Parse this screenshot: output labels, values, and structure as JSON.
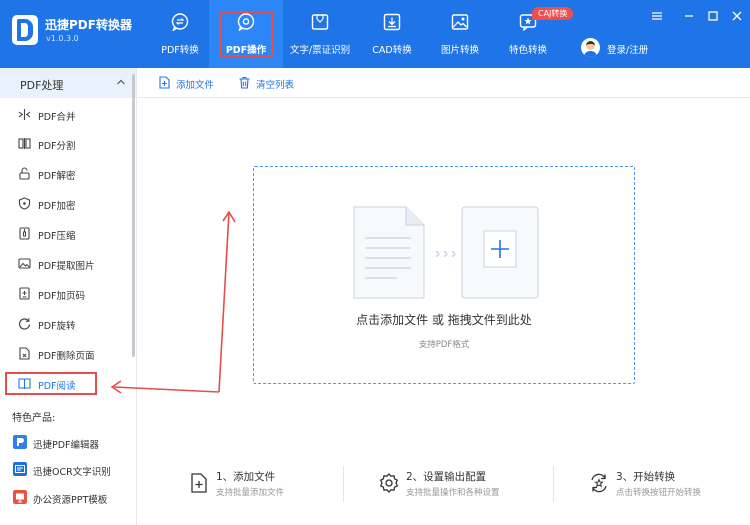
{
  "app": {
    "title": "迅捷PDF转换器",
    "version": "v1.0.3.0"
  },
  "nav": {
    "tabs": [
      {
        "label": "PDF转换",
        "icon": "chat-swap-icon"
      },
      {
        "label": "PDF操作",
        "icon": "chat-gear-icon"
      },
      {
        "label": "文字/票证识别",
        "icon": "scan-frame-icon"
      },
      {
        "label": "CAD转换",
        "icon": "download-box-icon"
      },
      {
        "label": "图片转换",
        "icon": "image-icon"
      },
      {
        "label": "特色转换",
        "icon": "star-chat-icon"
      }
    ],
    "badge": "CAJ转换",
    "login": "登录/注册"
  },
  "sidebar": {
    "header": "PDF处理",
    "items": [
      {
        "label": "PDF合并",
        "icon": "merge-icon"
      },
      {
        "label": "PDF分割",
        "icon": "split-icon"
      },
      {
        "label": "PDF解密",
        "icon": "unlock-icon"
      },
      {
        "label": "PDF加密",
        "icon": "shield-icon"
      },
      {
        "label": "PDF压缩",
        "icon": "compress-icon"
      },
      {
        "label": "PDF提取图片",
        "icon": "image-icon"
      },
      {
        "label": "PDF加页码",
        "icon": "page-number-icon"
      },
      {
        "label": "PDF旋转",
        "icon": "rotate-icon"
      },
      {
        "label": "PDF删除页面",
        "icon": "delete-page-icon"
      },
      {
        "label": "PDF阅读",
        "icon": "book-icon"
      }
    ],
    "selected": "PDF阅读",
    "featured_title": "特色产品:",
    "products": [
      {
        "label": "迅捷PDF编辑器",
        "icon": "pdf-editor-icon",
        "color": "#2f80ed"
      },
      {
        "label": "迅捷OCR文字识别",
        "icon": "ocr-icon",
        "color": "#1f6fd6"
      },
      {
        "label": "办公资源PPT模板",
        "icon": "ppt-icon",
        "color": "#e8553e"
      }
    ]
  },
  "toolbar": {
    "add_file": "添加文件",
    "clear_list": "清空列表"
  },
  "dropzone": {
    "main_text": "点击添加文件 或 拖拽文件到此处",
    "sub_text": "支持PDF格式"
  },
  "steps": [
    {
      "title": "1、添加文件",
      "desc": "支持批量添加文件",
      "icon": "add-file-icon"
    },
    {
      "title": "2、设置输出配置",
      "desc": "支持批量操作和各种设置",
      "icon": "settings-icon"
    },
    {
      "title": "3、开始转换",
      "desc": "点击转换按钮开始转换",
      "icon": "convert-icon"
    }
  ],
  "colors": {
    "brand": "#1f74e8",
    "annotation_red": "#e64d4d"
  }
}
